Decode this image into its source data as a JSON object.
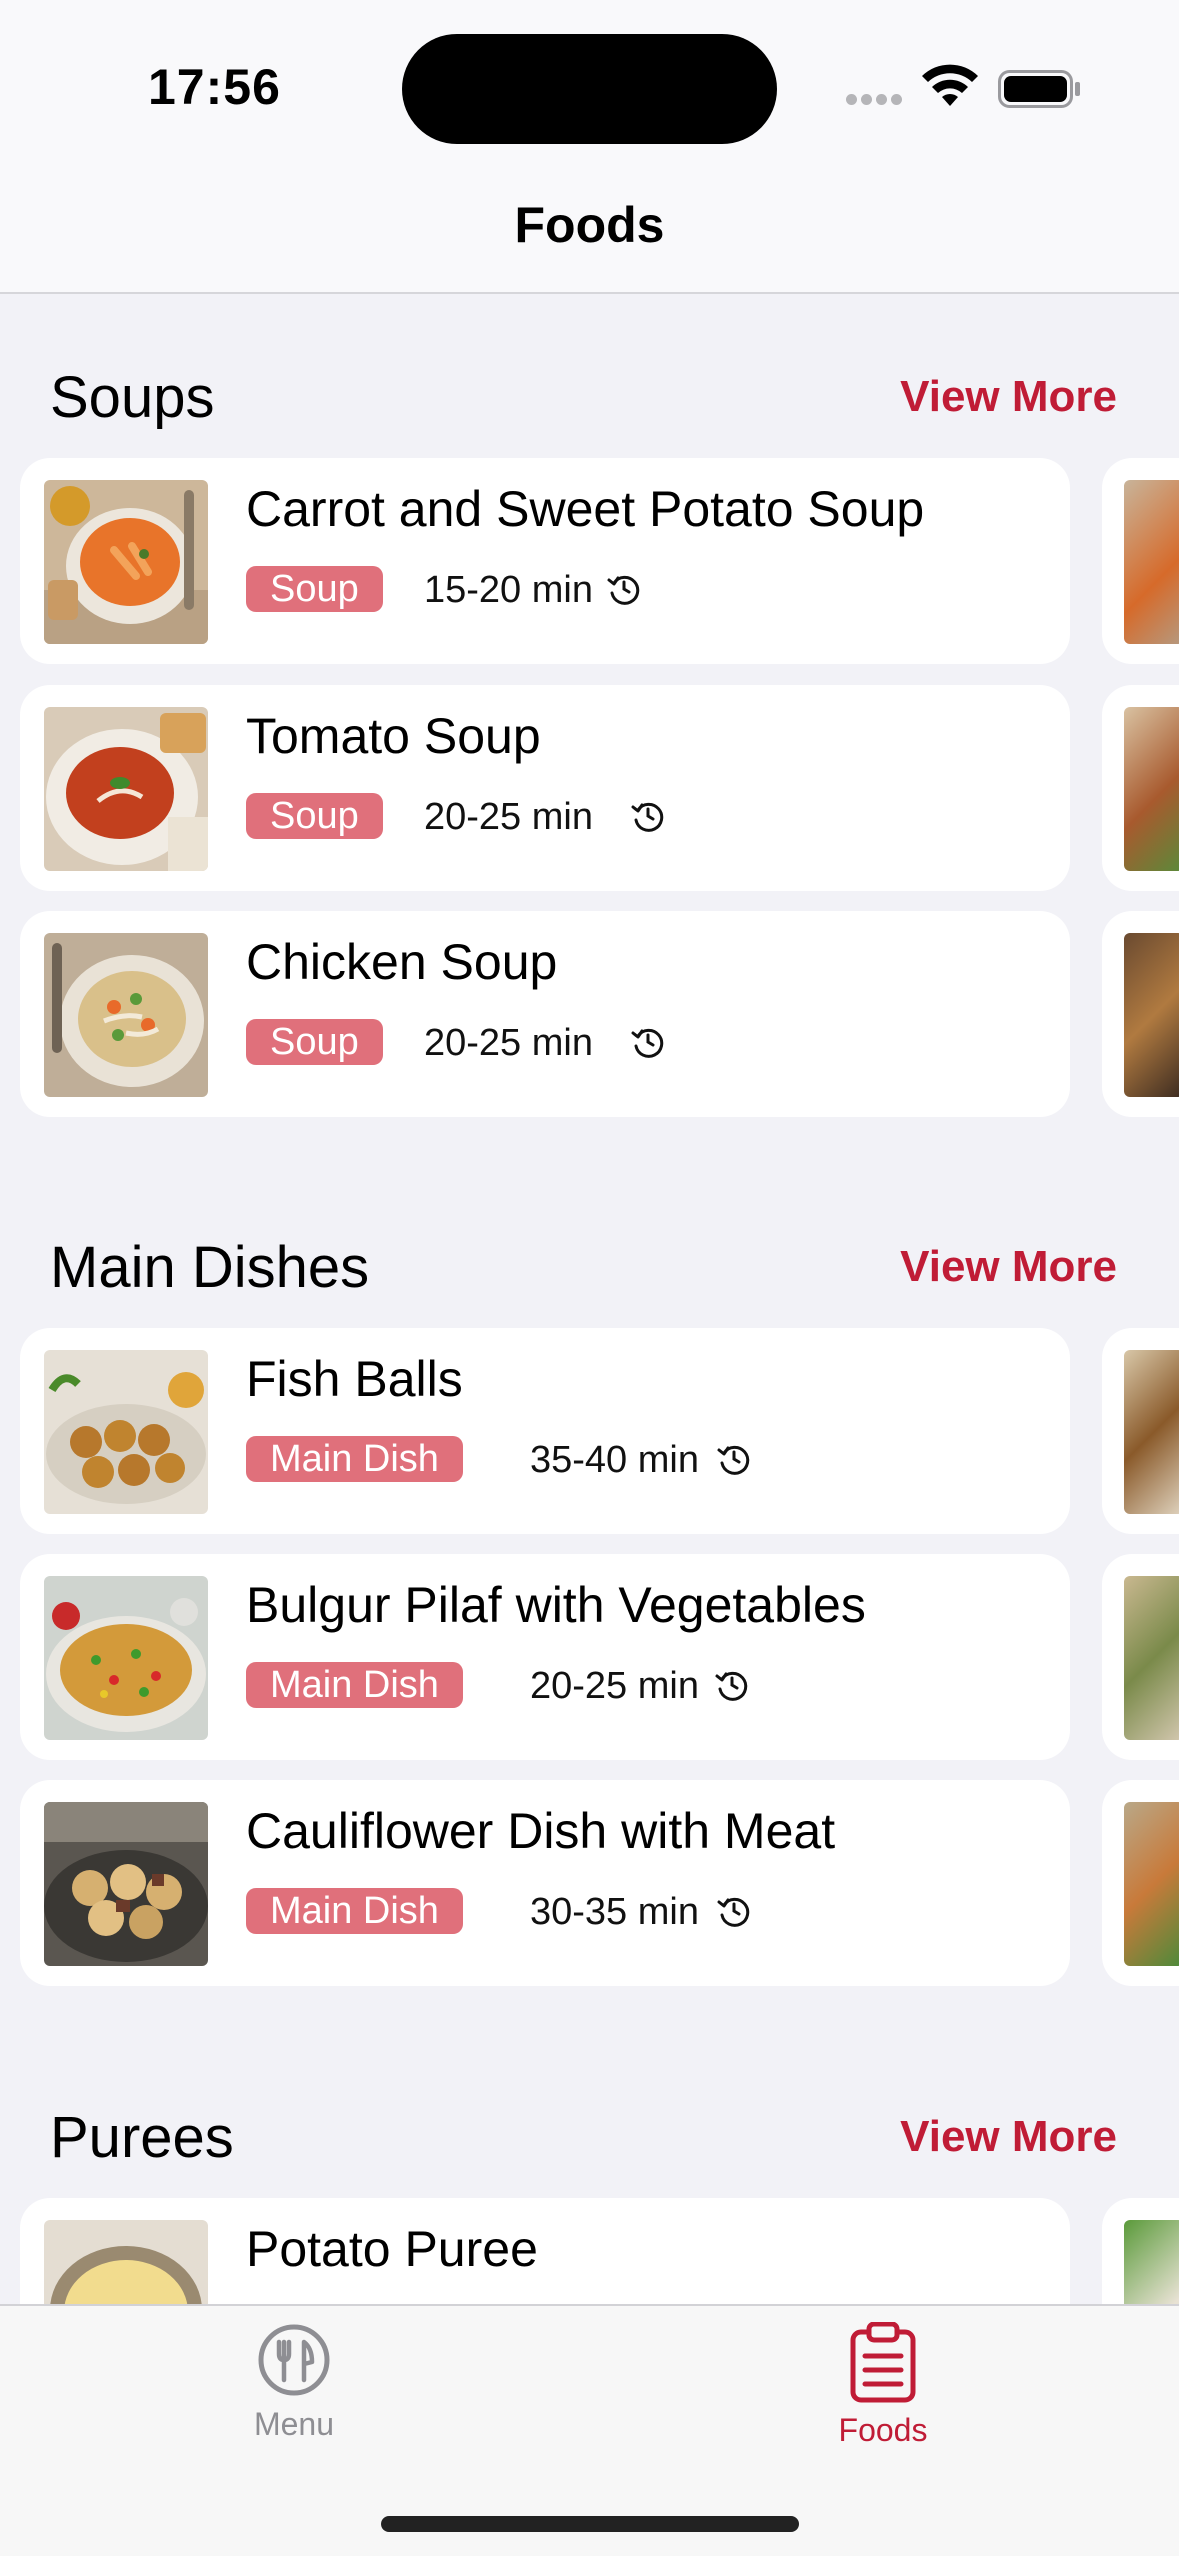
{
  "status_bar": {
    "time": "17:56"
  },
  "nav": {
    "title": "Foods"
  },
  "sections": [
    {
      "title": "Soups",
      "view_more": "View More",
      "items": [
        {
          "name": "Carrot and Sweet Potato Soup",
          "category": "Soup",
          "time": "15-20 min"
        },
        {
          "name": "Tomato Soup",
          "category": "Soup",
          "time": "20-25 min"
        },
        {
          "name": "Chicken Soup",
          "category": "Soup",
          "time": "20-25 min"
        }
      ]
    },
    {
      "title": "Main Dishes",
      "view_more": "View More",
      "items": [
        {
          "name": "Fish Balls",
          "category": "Main Dish",
          "time": "35-40 min"
        },
        {
          "name": "Bulgur Pilaf with Vegetables",
          "category": "Main Dish",
          "time": "20-25 min"
        },
        {
          "name": "Cauliflower Dish with Meat",
          "category": "Main Dish",
          "time": "30-35 min"
        }
      ]
    },
    {
      "title": "Purees",
      "view_more": "View More",
      "items": [
        {
          "name": "Potato Puree"
        }
      ]
    }
  ],
  "tab_bar": {
    "tabs": [
      {
        "label": "Menu",
        "icon": "fork-knife-icon",
        "selected": false
      },
      {
        "label": "Foods",
        "icon": "clipboard-list-icon",
        "selected": true
      }
    ]
  },
  "colors": {
    "accent": "#c01c36",
    "badge": "#e0707b",
    "background": "#f2f2f7",
    "tab_inactive": "#8e8e93"
  }
}
